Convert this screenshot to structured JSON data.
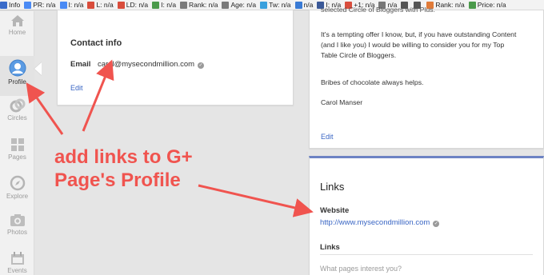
{
  "toolbar": {
    "items": [
      {
        "label": "Info",
        "icon": "info-icon",
        "color": "#3a6bc9"
      },
      {
        "label": "PR: n/a",
        "icon": "google-icon",
        "color": "#4a8af4"
      },
      {
        "label": "I: n/a",
        "icon": "google-icon",
        "color": "#4a8af4"
      },
      {
        "label": "L: n/a",
        "icon": "yahoo-icon",
        "color": "#d94d3c"
      },
      {
        "label": "LD: n/a",
        "icon": "yahoo-icon",
        "color": "#d94d3c"
      },
      {
        "label": "I: n/a",
        "icon": "bing-icon",
        "color": "#4b9a4b"
      },
      {
        "label": "Rank: n/a",
        "icon": "alexa-icon",
        "color": "#7a7a7a"
      },
      {
        "label": "Age: n/a",
        "icon": "archive-icon",
        "color": "#7a7a7a"
      },
      {
        "label": "Tw: n/a",
        "icon": "twitter-icon",
        "color": "#3aa0dd"
      },
      {
        "label": "n/a",
        "icon": "delicious-icon",
        "color": "#3a7bd5"
      },
      {
        "label": "I: n/a",
        "icon": "facebook-icon",
        "color": "#3b5998"
      },
      {
        "label": "+1: n/a",
        "icon": "plus-icon",
        "color": "#d94d3c"
      },
      {
        "label": "n/a",
        "icon": "compete-icon",
        "color": "#777777"
      },
      {
        "label": "",
        "icon": "source-icon",
        "color": "#555555"
      },
      {
        "label": "",
        "icon": "whois-icon",
        "color": "#555555"
      },
      {
        "label": "Rank: n/a",
        "icon": "semrush-icon",
        "color": "#e07b39"
      },
      {
        "label": "Price: n/a",
        "icon": "price-icon",
        "color": "#4b9a4b"
      }
    ]
  },
  "nav": {
    "home": "Home",
    "profile": "Profile",
    "circles": "Circles",
    "pages": "Pages",
    "explore": "Explore",
    "photos": "Photos",
    "events": "Events"
  },
  "contact": {
    "title": "Contact info",
    "email_label": "Email",
    "email_value": "carol@mysecondmillion.com",
    "edit": "Edit"
  },
  "intro": {
    "line0": "selected Circle of Bloggers with Plus.",
    "para1_l1": "It's a tempting offer I know, but, if you have outstanding Content",
    "para1_l2": "(and I like you) I would be willing to consider you for my Top",
    "para1_l3": "Table Circle of Bloggers.",
    "para2": "Bribes of chocolate always helps.",
    "signature": "Carol Manser",
    "edit": "Edit"
  },
  "links": {
    "title": "Links",
    "website_label": "Website",
    "website_url": "http://www.mysecondmillion.com",
    "links_label": "Links",
    "pages_placeholder": "What pages interest you?"
  },
  "annotation": {
    "line1": "add links to G+",
    "line2": "Page's Profile",
    "color": "#f0544f"
  }
}
